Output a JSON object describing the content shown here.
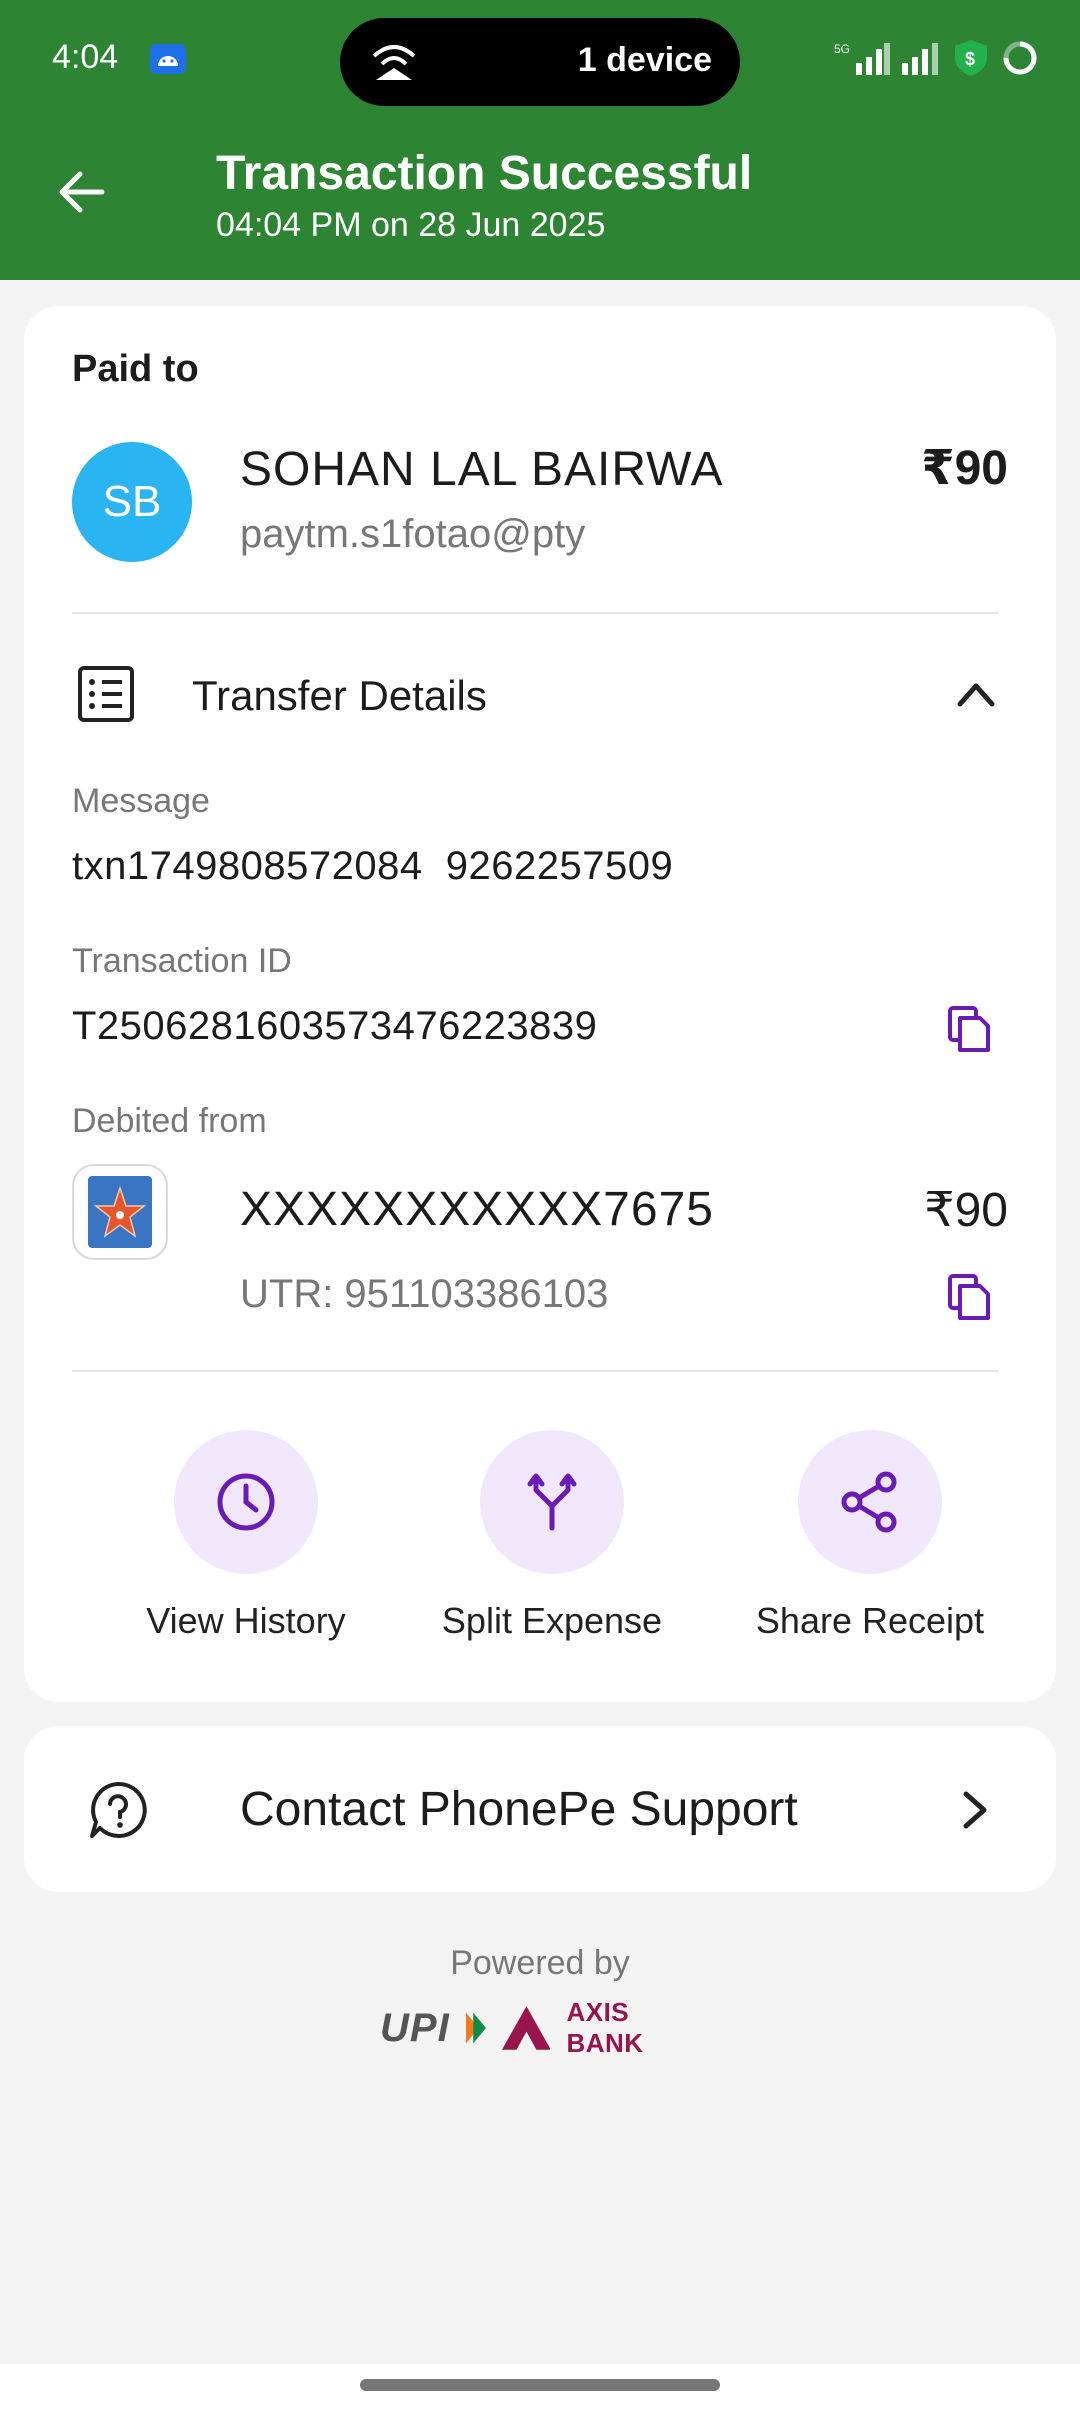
{
  "status_bar": {
    "time": "4:04",
    "hotspot_label": "1 device",
    "network_label": "5G"
  },
  "header": {
    "title": "Transaction Successful",
    "subtitle": "04:04 PM on 28 Jun 2025",
    "bg_color": "#2d8533"
  },
  "paid_to": {
    "label": "Paid to",
    "avatar_initials": "SB",
    "name": "SOHAN LAL BAIRWA",
    "upi_id": "paytm.s1fotao@pty",
    "amount": "₹90"
  },
  "transfer_details": {
    "label": "Transfer Details",
    "message_label": "Message",
    "message_value": "txn1749808572084  9262257509",
    "txn_id_label": "Transaction ID",
    "txn_id_value": "T2506281603573476223839",
    "debited_label": "Debited from",
    "account_number": "XXXXXXXXXXX7675",
    "account_amount": "₹90",
    "utr": "UTR: 951103386103"
  },
  "actions": [
    {
      "label": "View History",
      "icon": "clock-icon"
    },
    {
      "label": "Split Expense",
      "icon": "split-icon"
    },
    {
      "label": "Share Receipt",
      "icon": "share-icon"
    }
  ],
  "support": {
    "label": "Contact PhonePe Support"
  },
  "footer": {
    "powered_by": "Powered by",
    "upi_logo_text": "UPI",
    "bank_logo_text": "AXIS BANK"
  },
  "colors": {
    "accent_purple": "#6a1bb3",
    "action_bg": "#f1e7fb",
    "avatar_blue": "#2ab4f1"
  }
}
